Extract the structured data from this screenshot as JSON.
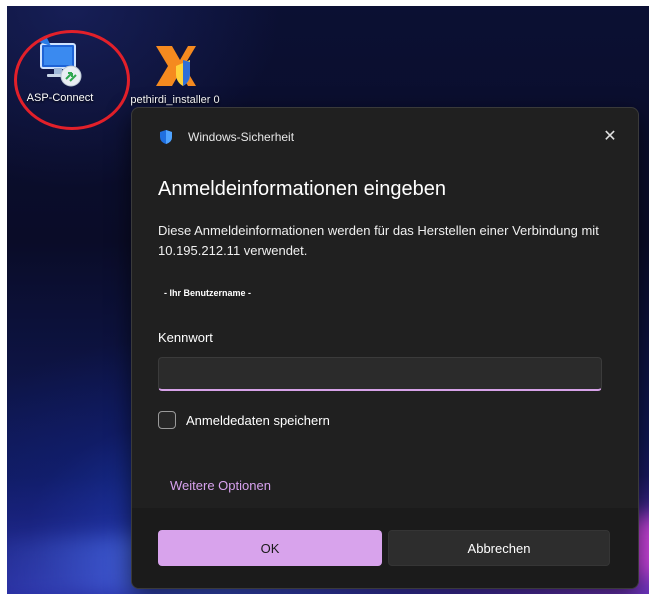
{
  "desktop": {
    "icons": [
      {
        "label": "ASP-Connect",
        "icon": "remote-desktop-icon"
      },
      {
        "label": "pethirdi_installer 0",
        "icon": "installer-icon"
      }
    ],
    "highlight_color": "#e2202a"
  },
  "dialog": {
    "title": "Windows-Sicherheit",
    "close_label": "✕",
    "heading": "Anmeldeinformationen eingeben",
    "description": "Diese Anmeldeinformationen werden für das Herstellen einer Verbindung mit 10.195.212.11 verwendet.",
    "username": "- Ihr Benutzername -",
    "password_label": "Kennwort",
    "password_value": "",
    "remember_label": "Anmeldedaten speichern",
    "remember_checked": false,
    "more_options": "Weitere Optionen",
    "ok_label": "OK",
    "cancel_label": "Abbrechen"
  },
  "colors": {
    "accent": "#d8a3ec",
    "dialog_bg": "#202020",
    "footer_bg": "#1b1b1b"
  }
}
